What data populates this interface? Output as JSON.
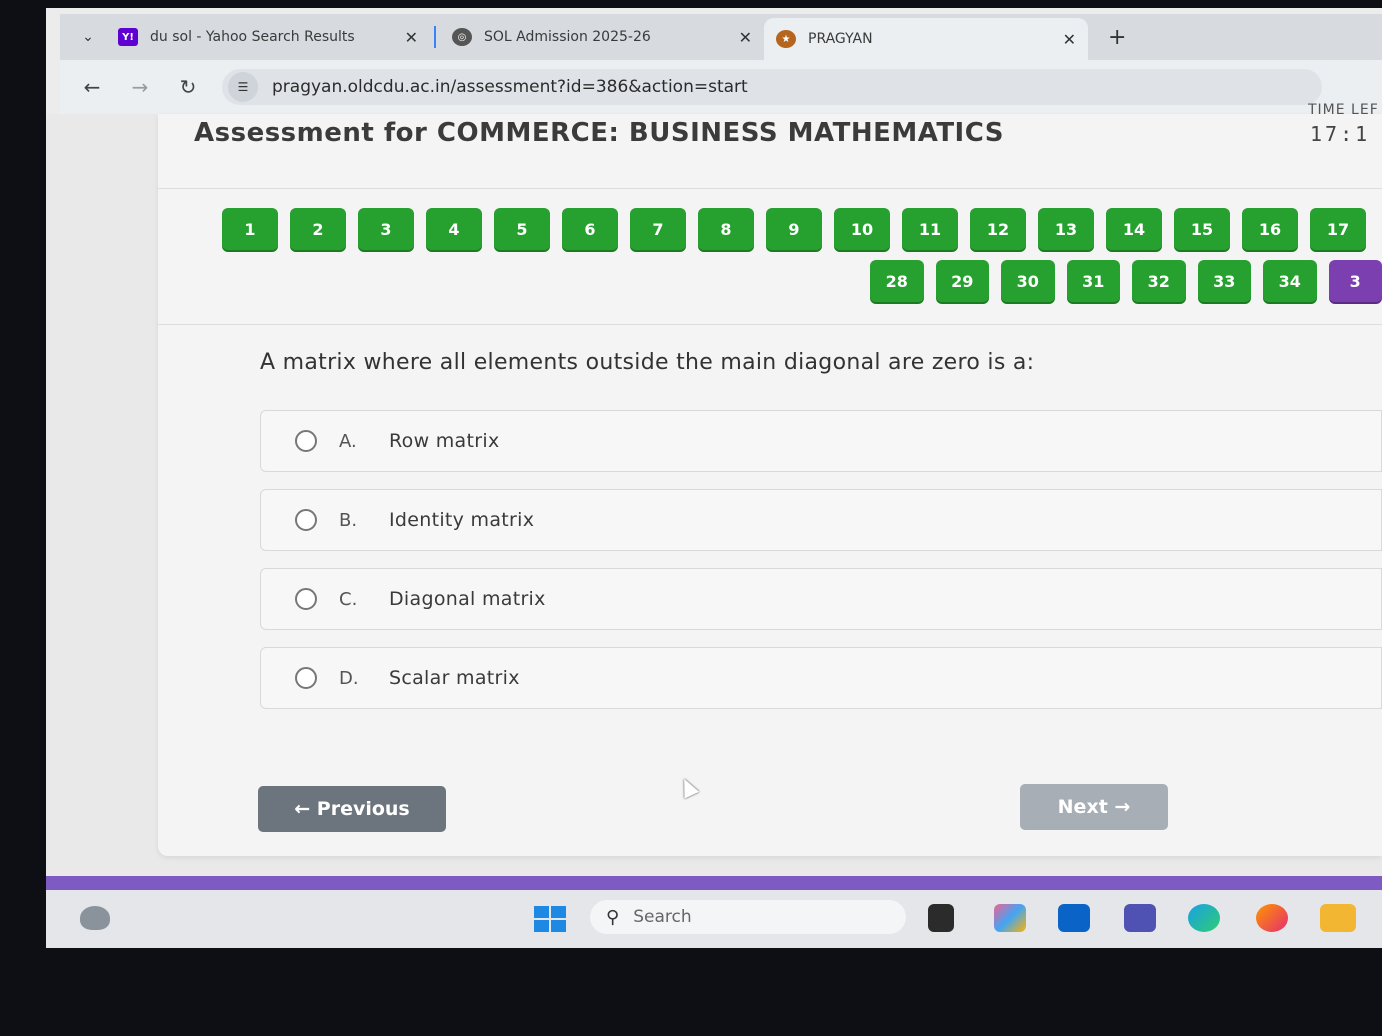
{
  "browser": {
    "tabs": [
      {
        "label": "du sol - Yahoo Search Results",
        "favicon": "yahoo-icon",
        "favicon_text": "Y!",
        "color": "#5f01d1"
      },
      {
        "label": "SOL Admission 2025-26",
        "favicon": "globe-icon",
        "color": "#555555"
      },
      {
        "label": "PRAGYAN",
        "favicon": "university-logo-icon",
        "color": "#b5651d"
      }
    ],
    "address": "pragyan.oldcdu.ac.in/assessment?id=386&action=start"
  },
  "assessment": {
    "title": "Assessment for COMMERCE: BUSINESS MATHEMATICS",
    "timer_label": "TIME LEF",
    "timer_value": "17:1",
    "question_numbers_row1": [
      "1",
      "2",
      "3",
      "4",
      "5",
      "6",
      "7",
      "8",
      "9",
      "10",
      "11",
      "12",
      "13",
      "14",
      "15",
      "16",
      "17"
    ],
    "question_numbers_row2": [
      "28",
      "29",
      "30",
      "31",
      "32",
      "33",
      "34",
      "3"
    ],
    "question": "A matrix where all elements outside the main diagonal are zero is a:",
    "options": [
      {
        "letter": "A.",
        "text": "Row matrix"
      },
      {
        "letter": "B.",
        "text": "Identity matrix"
      },
      {
        "letter": "C.",
        "text": "Diagonal matrix"
      },
      {
        "letter": "D.",
        "text": "Scalar matrix"
      }
    ],
    "prev_label": "← Previous",
    "next_label": "Next →"
  },
  "taskbar": {
    "search_placeholder": "Search",
    "apps": [
      "task-view-icon",
      "copilot-icon",
      "outlook-icon",
      "teams-icon",
      "edge-icon",
      "firefox-icon",
      "file-explorer-icon"
    ]
  },
  "colors": {
    "answered": "#26a02f",
    "current": "#7b3fb0",
    "accent_bar": "#7e5bc2"
  }
}
